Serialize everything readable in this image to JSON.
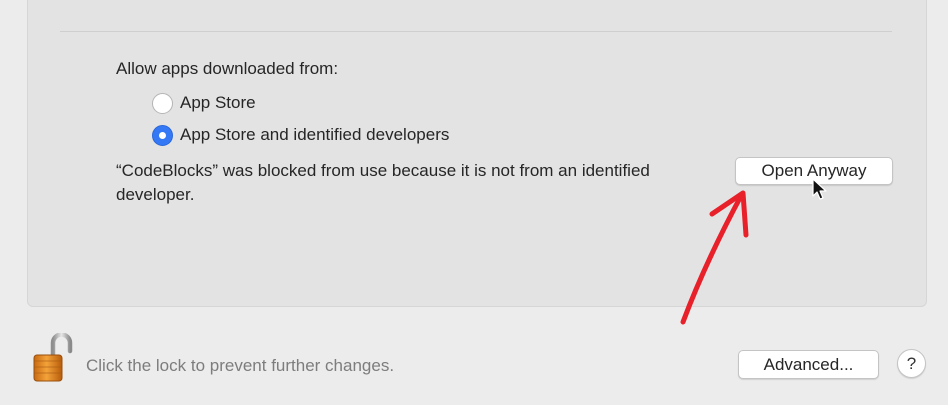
{
  "security": {
    "allow_label": "Allow apps downloaded from:",
    "options": [
      {
        "label": "App Store",
        "selected": false
      },
      {
        "label": "App Store and identified developers",
        "selected": true
      }
    ],
    "blocked_message": "“CodeBlocks” was blocked from use because it is not from an identified developer.",
    "open_anyway_label": "Open Anyway"
  },
  "footer": {
    "lock_text": "Click the lock to prevent further changes.",
    "lock_icon": "unlocked-padlock-icon",
    "advanced_label": "Advanced...",
    "help_label": "?"
  },
  "annotation": {
    "arrow_color": "#e8202a",
    "arrow_target": "open-anyway-button"
  },
  "colors": {
    "accent": "#3478f6",
    "panel_bg": "#e3e3e3",
    "window_bg": "#ececec"
  }
}
